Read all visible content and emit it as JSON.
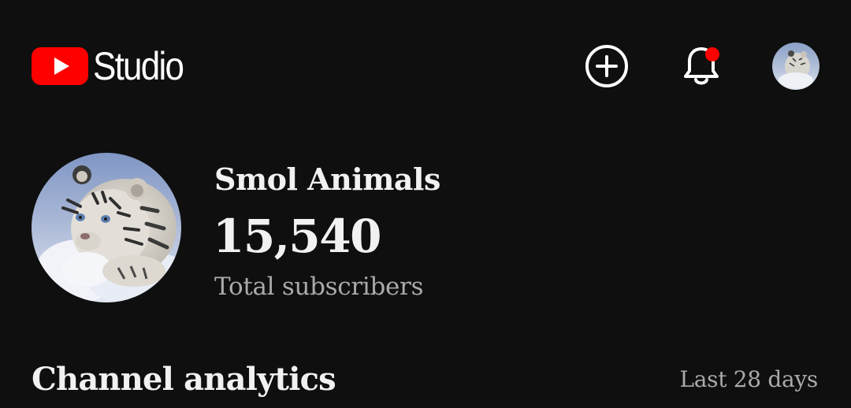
{
  "header": {
    "app_name": "Studio",
    "brand_color": "#ff0000",
    "icons": {
      "logo": "youtube-play-icon",
      "create": "plus-circle-icon",
      "notifications": "bell-icon",
      "account": "account-avatar"
    },
    "has_notification_dot": true
  },
  "channel": {
    "name": "Smol Animals",
    "subscriber_count": "15,540",
    "subscriber_label": "Total subscribers",
    "avatar": "white-tiger-cub-avatar"
  },
  "analytics": {
    "title": "Channel analytics",
    "range": "Last 28 days"
  }
}
